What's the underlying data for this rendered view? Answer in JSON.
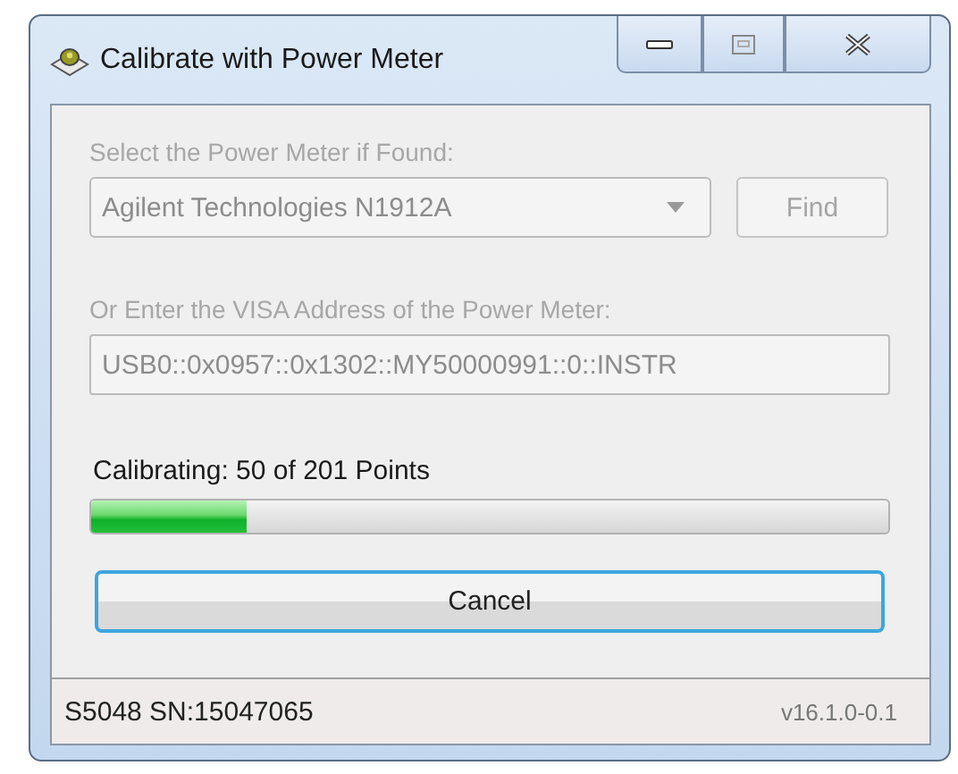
{
  "window": {
    "title": "Calibrate with Power Meter"
  },
  "meter_select": {
    "label": "Select the Power Meter if Found:",
    "value": "Agilent Technologies N1912A",
    "disabled": true
  },
  "find_button": {
    "label": "Find",
    "disabled": true
  },
  "visa_address": {
    "label": "Or Enter the VISA Address of the Power Meter:",
    "value": "USB0::0x0957::0x1302::MY50000991::0::INSTR",
    "disabled": true
  },
  "progress": {
    "label": "Calibrating: 50 of 201 Points",
    "level": 0.196
  },
  "cancel_button": {
    "label": "Cancel"
  },
  "status_bar": {
    "serial": "S5048 SN:15047065",
    "version": "v16.1.0-0.1"
  }
}
